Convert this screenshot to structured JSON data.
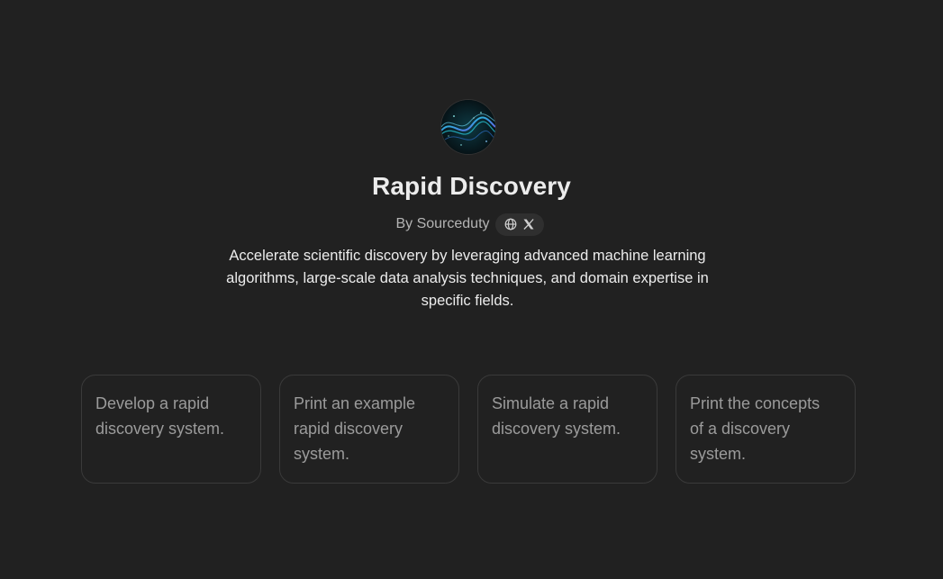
{
  "gpt": {
    "name": "Rapid Discovery",
    "author_prefix": "By Sourceduty",
    "description": "Accelerate scientific discovery by leveraging advanced machine learning algorithms, large-scale data analysis techniques, and domain expertise in specific fields.",
    "avatar_icon": "abstract-wave-avatar",
    "links": [
      {
        "icon": "globe-icon"
      },
      {
        "icon": "x-logo-icon"
      }
    ]
  },
  "conversation_starters": [
    {
      "text": "Develop a rapid discovery system."
    },
    {
      "text": "Print an example rapid discovery system."
    },
    {
      "text": "Simulate a rapid discovery system."
    },
    {
      "text": "Print the concepts of a discovery system."
    }
  ],
  "colors": {
    "background": "#212121",
    "text_primary": "#ececec",
    "text_secondary": "#b4b4b4",
    "card_border": "#3a3a3a",
    "card_text": "#9b9b9b",
    "pill_background": "#2f2f2f"
  }
}
